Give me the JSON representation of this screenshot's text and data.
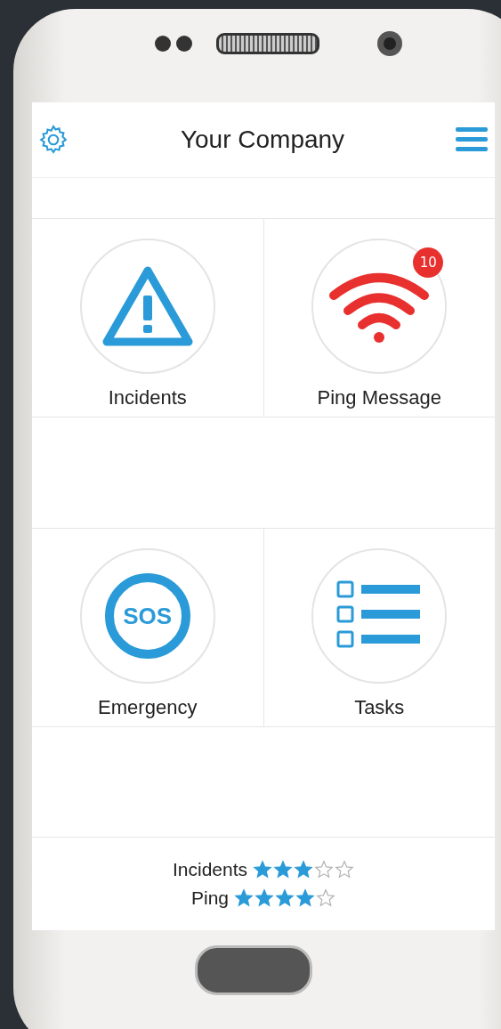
{
  "header": {
    "title": "Your Company"
  },
  "tiles": [
    {
      "kind": "incidents",
      "label": "Incidents"
    },
    {
      "kind": "ping",
      "label": "Ping Message",
      "badge": "10"
    },
    {
      "kind": "sos",
      "label": "Emergency",
      "icon_text": "SOS"
    },
    {
      "kind": "tasks",
      "label": "Tasks"
    }
  ],
  "ratings": [
    {
      "label": "Incidents",
      "stars": 3
    },
    {
      "label": "Ping",
      "stars": 4
    }
  ]
}
